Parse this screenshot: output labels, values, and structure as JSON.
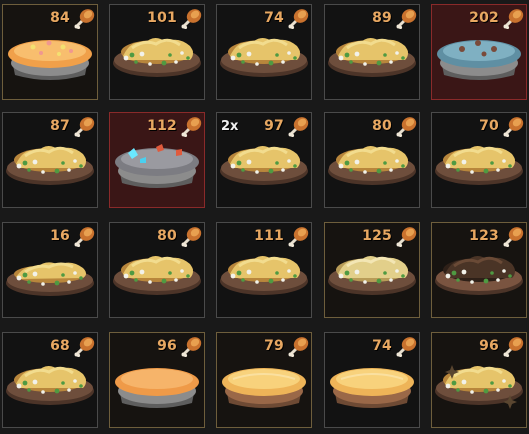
{
  "inventory": {
    "slots": [
      {
        "count": "84",
        "multiplier": "",
        "kind": "pie-orange",
        "frame": "gold"
      },
      {
        "count": "101",
        "multiplier": "",
        "kind": "stew",
        "frame": "grey"
      },
      {
        "count": "74",
        "multiplier": "",
        "kind": "stew",
        "frame": "grey"
      },
      {
        "count": "89",
        "multiplier": "",
        "kind": "stew",
        "frame": "grey"
      },
      {
        "count": "202",
        "multiplier": "",
        "kind": "pie-blue",
        "frame": "red"
      },
      {
        "count": "87",
        "multiplier": "",
        "kind": "stew",
        "frame": "grey"
      },
      {
        "count": "112",
        "multiplier": "",
        "kind": "pie-grey",
        "frame": "red"
      },
      {
        "count": "97",
        "multiplier": "2x",
        "kind": "stew",
        "frame": "grey"
      },
      {
        "count": "80",
        "multiplier": "",
        "kind": "stew",
        "frame": "grey"
      },
      {
        "count": "70",
        "multiplier": "",
        "kind": "stew",
        "frame": "grey"
      },
      {
        "count": "16",
        "multiplier": "",
        "kind": "stew-flat",
        "frame": "grey"
      },
      {
        "count": "80",
        "multiplier": "",
        "kind": "stew",
        "frame": "grey"
      },
      {
        "count": "111",
        "multiplier": "",
        "kind": "stew",
        "frame": "grey"
      },
      {
        "count": "125",
        "multiplier": "",
        "kind": "stew-pale",
        "frame": "gold"
      },
      {
        "count": "123",
        "multiplier": "",
        "kind": "stew-dark",
        "frame": "gold"
      },
      {
        "count": "68",
        "multiplier": "",
        "kind": "stew",
        "frame": "grey"
      },
      {
        "count": "96",
        "multiplier": "",
        "kind": "pie-plain",
        "frame": "gold"
      },
      {
        "count": "79",
        "multiplier": "",
        "kind": "pie-golden",
        "frame": "gold"
      },
      {
        "count": "74",
        "multiplier": "",
        "kind": "pie-golden",
        "frame": "grey"
      },
      {
        "count": "96",
        "multiplier": "",
        "kind": "stew-sparkle",
        "frame": "gold"
      }
    ],
    "count_icon": "drumstick-icon",
    "colors": {
      "count_text": "#e8a862",
      "rare_frame": "#8a2a2a",
      "pie_crust": "#f0a04a",
      "stew_gold": "#e6c46a",
      "plate": "#7a5a44"
    }
  }
}
